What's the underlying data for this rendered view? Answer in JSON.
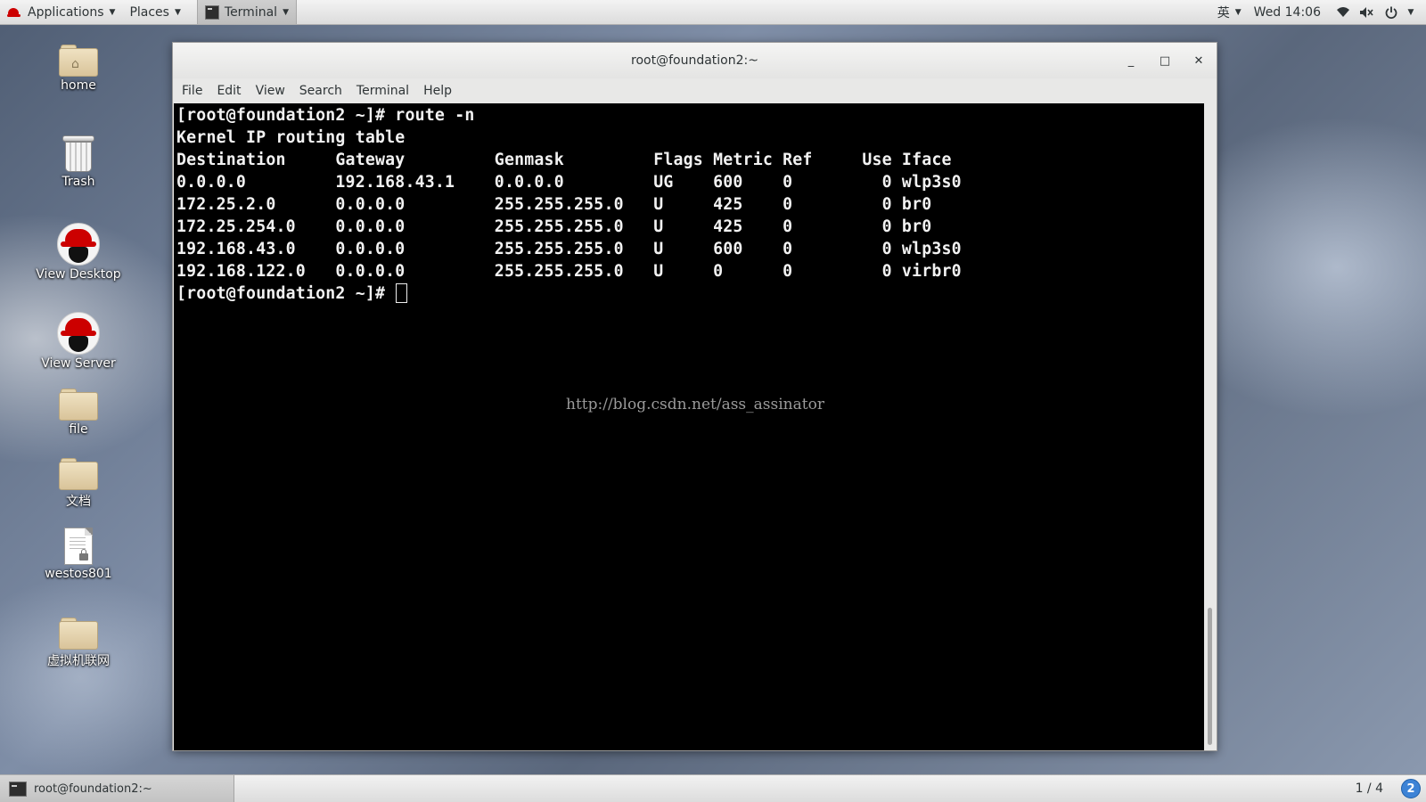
{
  "top_panel": {
    "applications": "Applications",
    "places": "Places",
    "active_app": "Terminal",
    "input_method": "英",
    "clock": "Wed 14:06"
  },
  "desktop": {
    "icons": [
      {
        "label": "home",
        "icon": "home-folder-icon"
      },
      {
        "label": "Trash",
        "icon": "trash-icon"
      },
      {
        "label": "View Desktop",
        "icon": "redhat-icon"
      },
      {
        "label": "View Server",
        "icon": "redhat-icon"
      },
      {
        "label": "file",
        "icon": "folder-icon"
      },
      {
        "label": "文档",
        "icon": "folder-icon"
      },
      {
        "label": "westos801",
        "icon": "locked-document-icon"
      },
      {
        "label": "虚拟机联网",
        "icon": "folder-icon"
      }
    ]
  },
  "window": {
    "title": "root@foundation2:~",
    "menu": [
      "File",
      "Edit",
      "View",
      "Search",
      "Terminal",
      "Help"
    ],
    "buttons": {
      "minimize": "_",
      "maximize": "□",
      "close": "✕"
    }
  },
  "terminal": {
    "command_line": "[root@foundation2 ~]# route -n",
    "table_title": "Kernel IP routing table",
    "columns": [
      "Destination",
      "Gateway",
      "Genmask",
      "Flags",
      "Metric",
      "Ref",
      "Use",
      "Iface"
    ],
    "rows": [
      [
        "0.0.0.0",
        "192.168.43.1",
        "0.0.0.0",
        "UG",
        "600",
        "0",
        "0",
        "wlp3s0"
      ],
      [
        "172.25.2.0",
        "0.0.0.0",
        "255.255.255.0",
        "U",
        "425",
        "0",
        "0",
        "br0"
      ],
      [
        "172.25.254.0",
        "0.0.0.0",
        "255.255.255.0",
        "U",
        "425",
        "0",
        "0",
        "br0"
      ],
      [
        "192.168.43.0",
        "0.0.0.0",
        "255.255.255.0",
        "U",
        "600",
        "0",
        "0",
        "wlp3s0"
      ],
      [
        "192.168.122.0",
        "0.0.0.0",
        "255.255.255.0",
        "U",
        "0",
        "0",
        "0",
        "virbr0"
      ]
    ],
    "prompt": "[root@foundation2 ~]# ",
    "watermark": "http://blog.csdn.net/ass_assinator"
  },
  "taskbar": {
    "task_label": "root@foundation2:~",
    "workspace": "1 / 4",
    "notification_count": "2"
  },
  "colors": {
    "terminal_bg": "#000000",
    "terminal_fg": "#f2f2f2",
    "redhat_red": "#cc0000",
    "badge_blue": "#3d83d6"
  }
}
